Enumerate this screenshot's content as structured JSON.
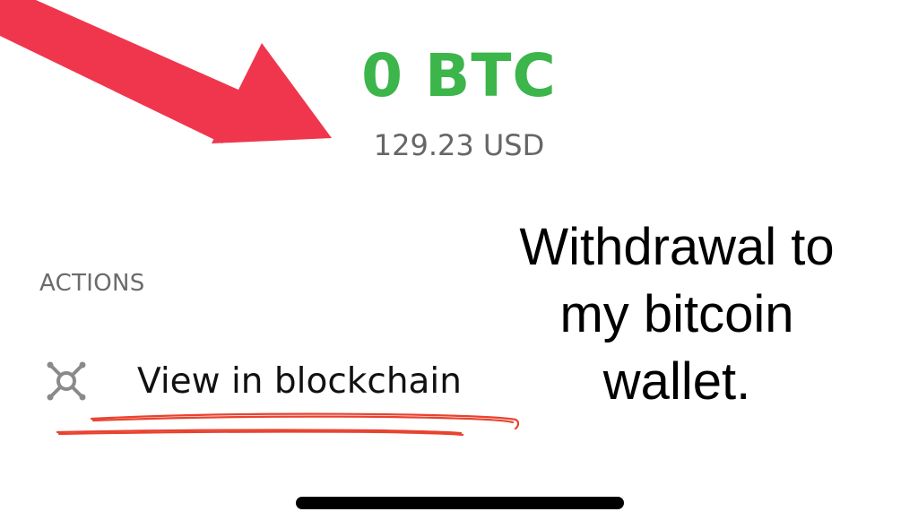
{
  "balance": {
    "crypto": "0 BTC",
    "fiat": "129.23 USD"
  },
  "actions": {
    "header": "ACTIONS",
    "items": [
      {
        "label": "View in blockchain",
        "icon": "blockchain-node-icon"
      }
    ]
  },
  "annotation": {
    "lines": [
      "Withdrawal to",
      "my bitcoin",
      "wallet."
    ],
    "arrow_color": "#f0364d",
    "underline_color": "#e8432f"
  },
  "colors": {
    "crypto_balance": "#3cb54a",
    "fiat_balance": "#666666"
  }
}
